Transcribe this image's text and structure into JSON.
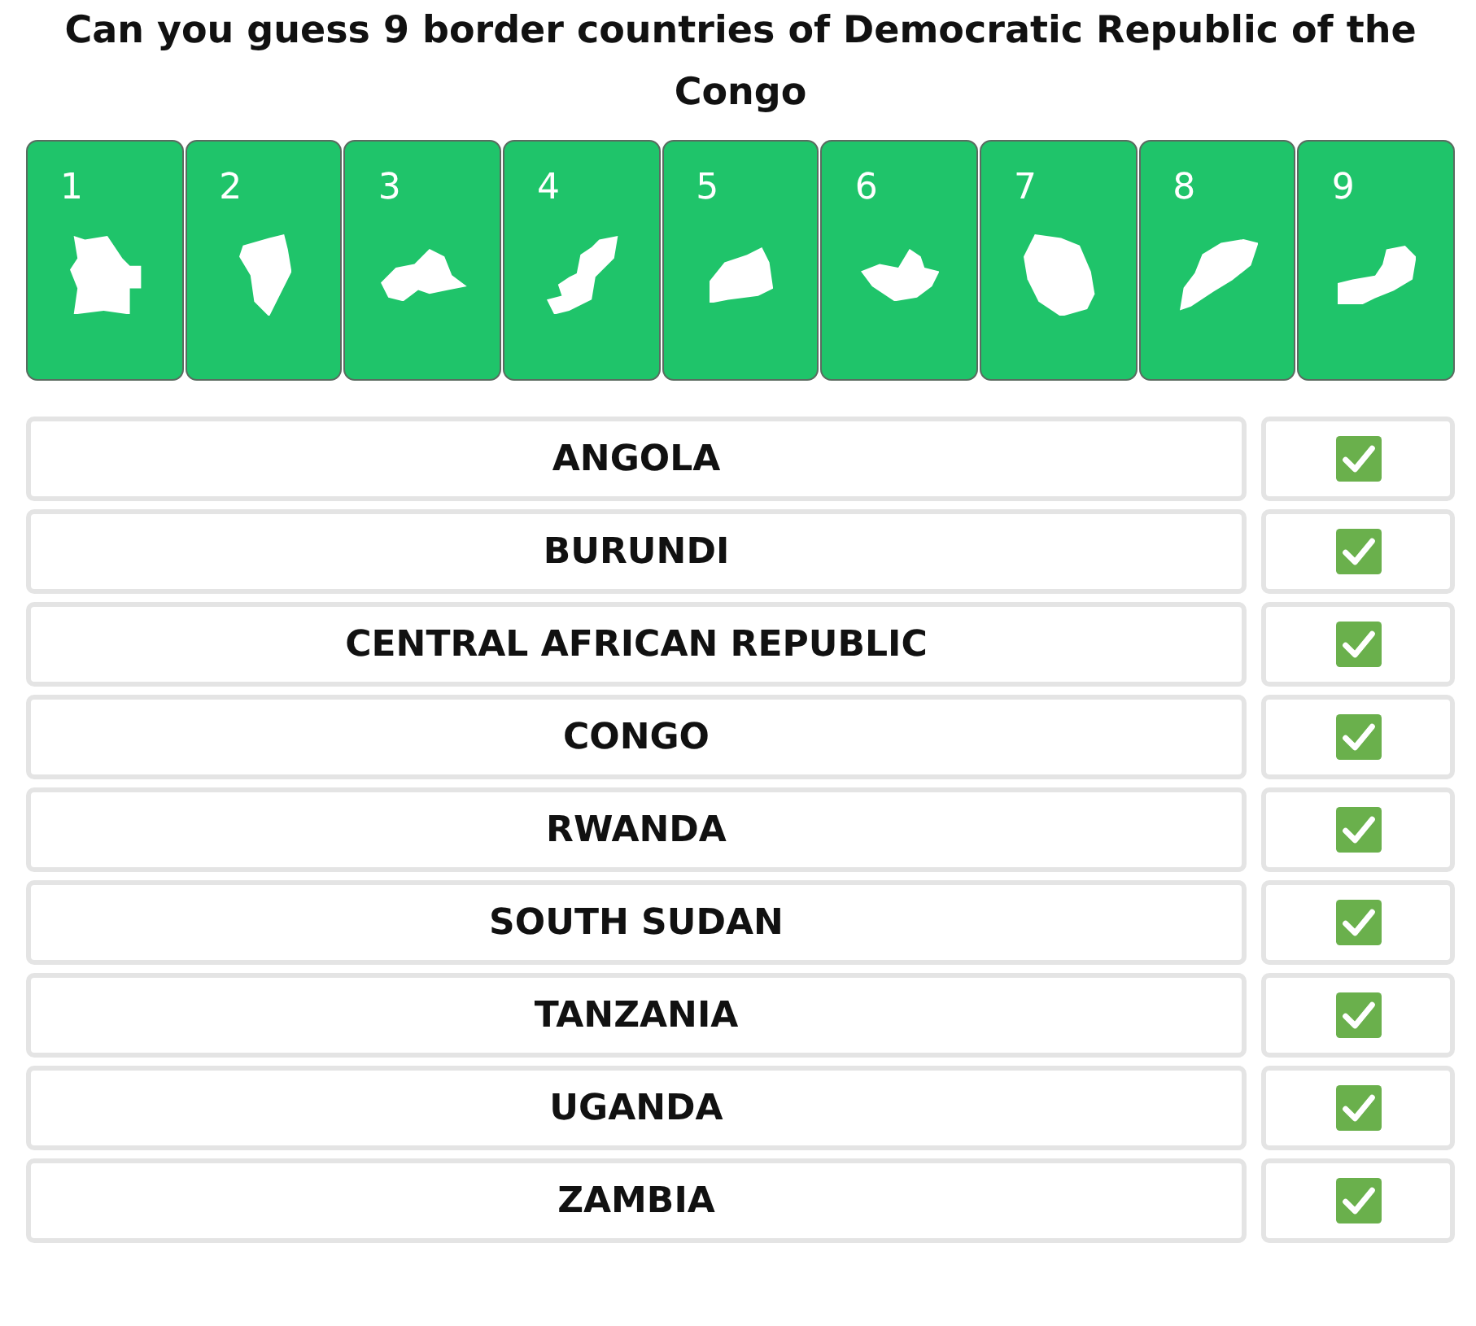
{
  "title": "Can you guess 9 border countries of Democratic Republic of the Congo",
  "cards": [
    {
      "number": "1"
    },
    {
      "number": "2"
    },
    {
      "number": "3"
    },
    {
      "number": "4"
    },
    {
      "number": "5"
    },
    {
      "number": "6"
    },
    {
      "number": "7"
    },
    {
      "number": "8"
    },
    {
      "number": "9"
    }
  ],
  "answers": [
    {
      "name": "ANGOLA",
      "correct": true
    },
    {
      "name": "BURUNDI",
      "correct": true
    },
    {
      "name": "CENTRAL AFRICAN REPUBLIC",
      "correct": true
    },
    {
      "name": "CONGO",
      "correct": true
    },
    {
      "name": "RWANDA",
      "correct": true
    },
    {
      "name": "SOUTH SUDAN",
      "correct": true
    },
    {
      "name": "TANZANIA",
      "correct": true
    },
    {
      "name": "UGANDA",
      "correct": true
    },
    {
      "name": "ZAMBIA",
      "correct": true
    }
  ]
}
